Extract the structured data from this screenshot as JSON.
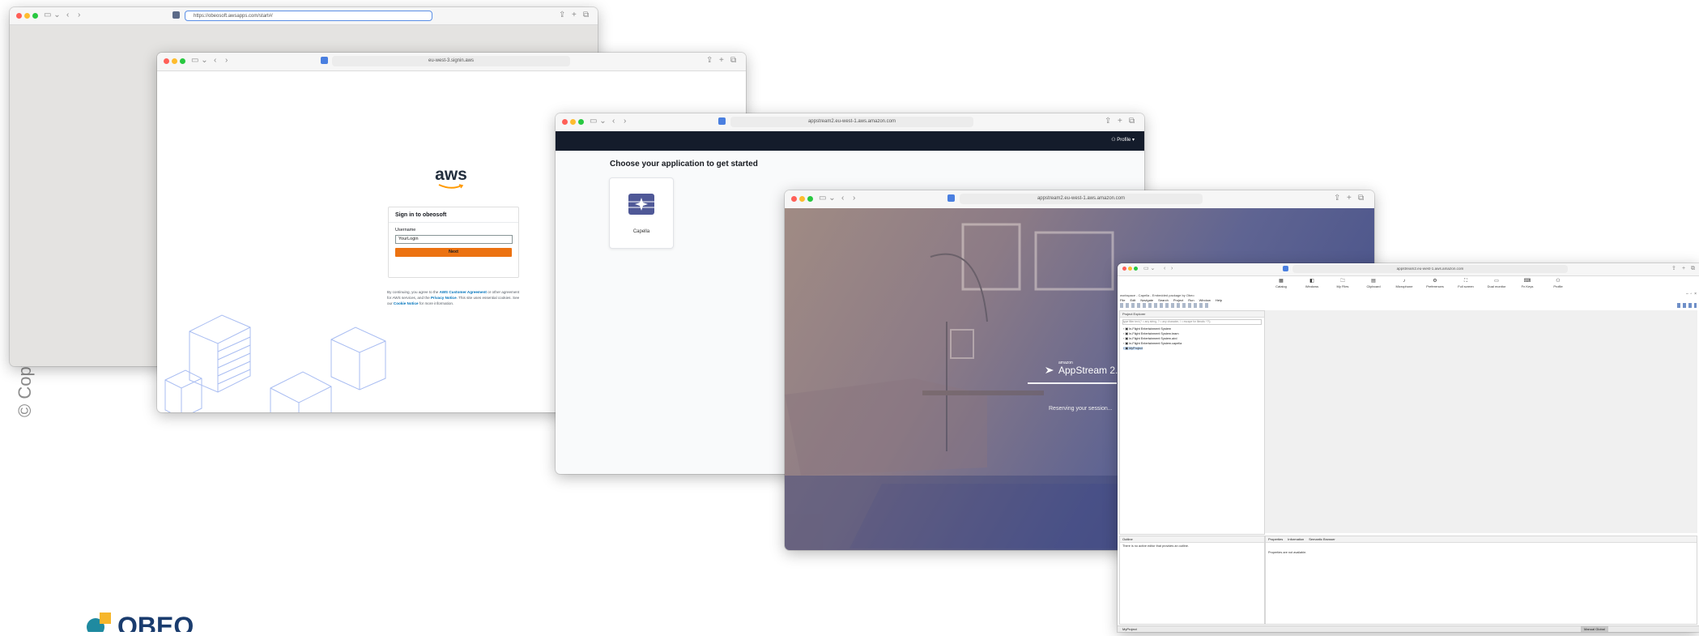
{
  "copyright": "© Copyright Obeo",
  "brand": {
    "name": "OBEO",
    "colors": {
      "teal": "#1f8aa0",
      "yellow": "#f6b62b",
      "navy": "#1a3c6e"
    }
  },
  "window1": {
    "url": "https://obeosoft.awsapps.com/start#/"
  },
  "window2": {
    "url": "eu-west-3.signin.aws",
    "aws_logo": "aws",
    "heading": "Sign in to obeosoft",
    "username_label": "Username",
    "username_value": "YourLogin",
    "next_button": "Next",
    "legal": {
      "p1": "By continuing, you agree to the ",
      "link1": "AWS Customer Agreement",
      "p2": " or other agreement for AWS services, and the ",
      "link2": "Privacy Notice",
      "p3": ". This site uses essential cookies. See our ",
      "link3": "Cookie Notice",
      "p4": " for more information."
    }
  },
  "window3": {
    "url": "appstream2.eu-west-1.aws.amazon.com",
    "profile_label": "Profile",
    "heading": "Choose your application to get started",
    "app_name": "Capella"
  },
  "window4": {
    "url": "appstream2.eu-west-1.aws.amazon.com",
    "brand_small": "amazon",
    "brand_name": "AppStream 2.0",
    "status": "Reserving your session..."
  },
  "window5": {
    "url": "appstream2.eu-west-1.aws.amazon.com",
    "toolbar": [
      {
        "label": "Catalog",
        "icon": "grid-icon"
      },
      {
        "label": "Windows",
        "icon": "windows-icon"
      },
      {
        "label": "My Files",
        "icon": "folder-icon"
      },
      {
        "label": "Clipboard",
        "icon": "clipboard-icon"
      },
      {
        "label": "Microphone",
        "icon": "microphone-icon"
      },
      {
        "label": "Preferences",
        "icon": "gear-icon"
      },
      {
        "label": "Full screen",
        "icon": "fullscreen-icon"
      },
      {
        "label": "Dual monitor",
        "icon": "monitor-icon"
      },
      {
        "label": "Fn Keys",
        "icon": "keys-icon"
      },
      {
        "label": "Profile",
        "icon": "user-icon"
      }
    ],
    "title": "workspace - Capella - Embedded package by Obeo",
    "menu": [
      "File",
      "Edit",
      "Navigate",
      "Search",
      "Project",
      "Run",
      "Window",
      "Help"
    ],
    "project_explorer": "Project Explorer",
    "filter_placeholder": "type filter text (* = any string, ? = any character, \\ = escape for literals: *?\\)",
    "tree": [
      "In-Flight Entertainment System",
      "In-Flight Entertainment System.team",
      "In-Flight Entertainment System.aird",
      "In-Flight Entertainment System.capella",
      "MyProject"
    ],
    "outline": "Outline",
    "outline_msg": "There is no active editor that provides an outline.",
    "properties_tabs": [
      "Properties",
      "Information",
      "Semantic Browser"
    ],
    "properties_msg": "Properties are not available.",
    "status_left": "MyProject",
    "status_right": "Manual Global"
  }
}
